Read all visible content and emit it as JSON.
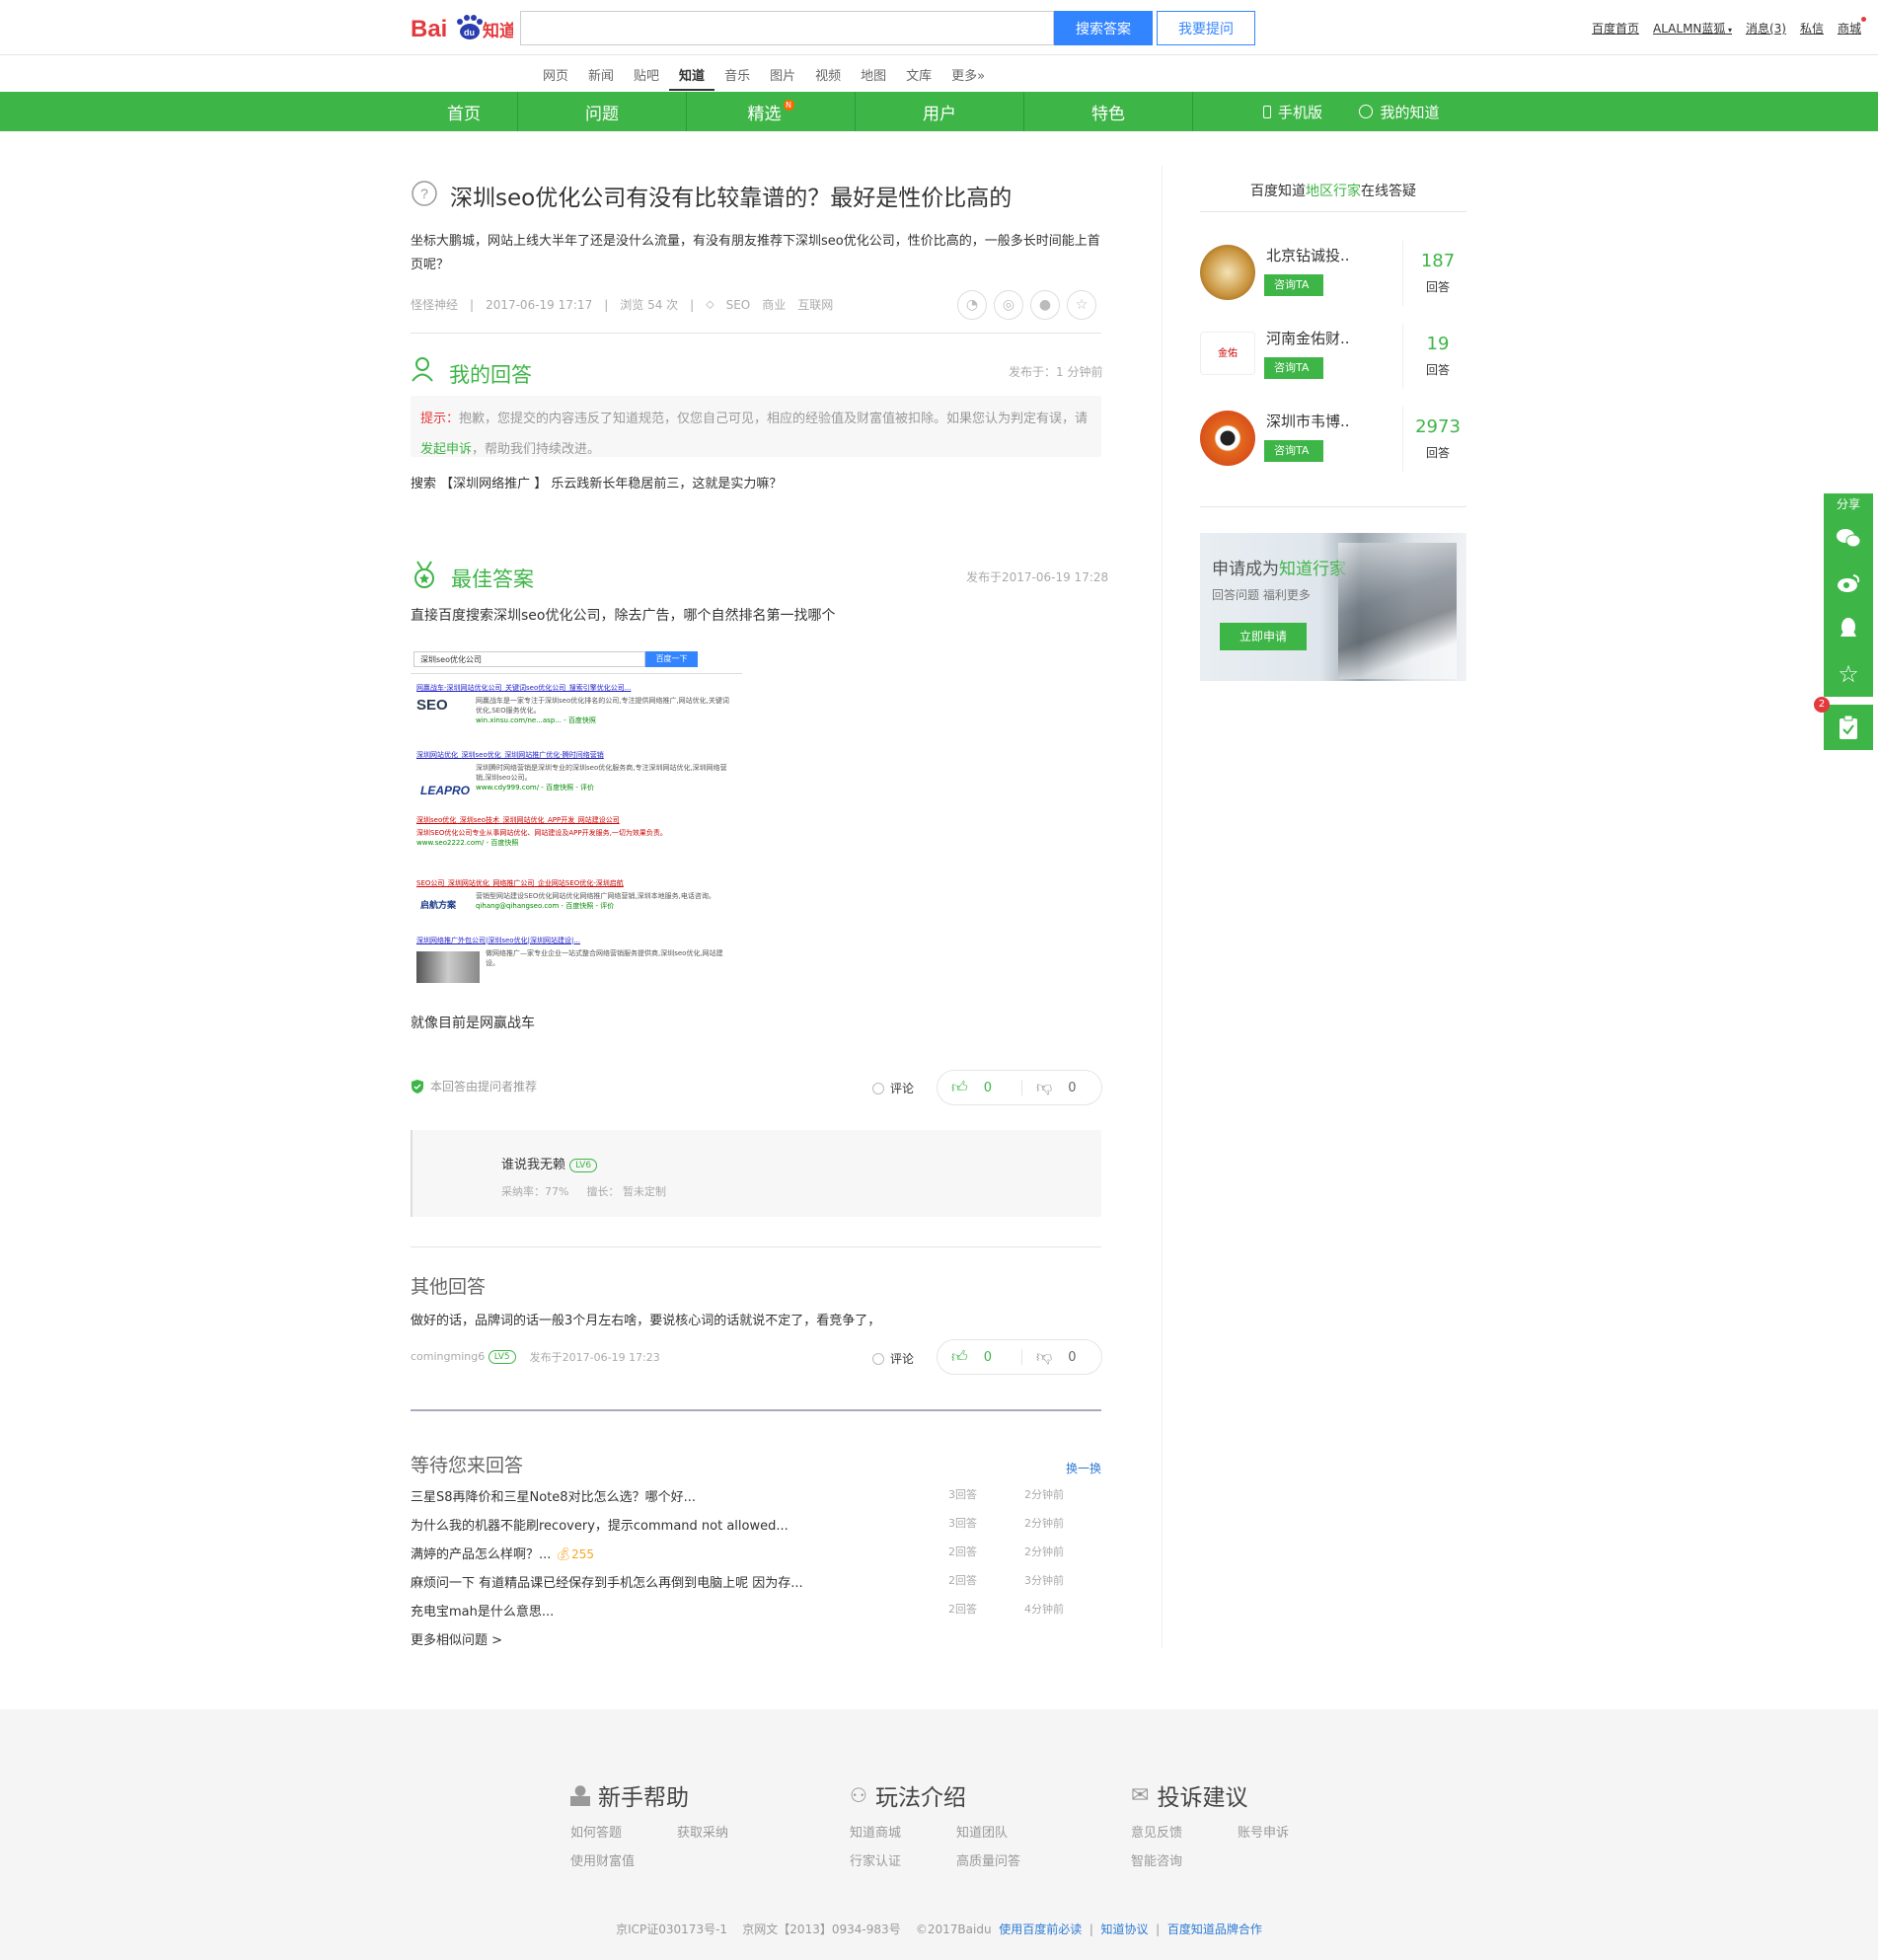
{
  "topbar": {
    "logo_text": "Bai知道",
    "search_value": "",
    "search_button": "搜索答案",
    "ask_button": "我要提问",
    "links": [
      "百度首页",
      "ALALMN蓝狐",
      "消息(3)",
      "私信",
      "商城"
    ]
  },
  "channels": [
    "网页",
    "新闻",
    "贴吧",
    "知道",
    "音乐",
    "图片",
    "视频",
    "地图",
    "文库",
    "更多»"
  ],
  "active_channel": "知道",
  "greennav": {
    "items": [
      "首页",
      "问题",
      "精选",
      "用户",
      "特色"
    ],
    "badge": "N",
    "mobile": "手机版",
    "my": "我的知道"
  },
  "question": {
    "title": "深圳seo优化公司有没有比较靠谱的？最好是性价比高的",
    "body": "坐标大鹏城，网站上线大半年了还是没什么流量，有没有朋友推荐下深圳seo优化公司，性价比高的，一般多长时间能上首页呢？",
    "author": "怪怪神经",
    "date": "2017-06-19 17:17",
    "views": "浏览 54 次",
    "tags": [
      "SEO",
      "商业",
      "互联网"
    ]
  },
  "my_answer": {
    "heading": "我的回答",
    "time": "发布于：1 分钟前",
    "tip_label": "提示：",
    "tip_text": "抱歉，您提交的内容违反了知道规范，仅您自己可见，相应的经验值及财富值被扣除。如果您认为判定有误，请",
    "tip_link": "发起申诉",
    "tip_tail": "，帮助我们持续改进。",
    "content": "搜索 【深圳网络推广 】 乐云践新长年稳居前三，这就是实力嘛？"
  },
  "best_answer": {
    "heading": "最佳答案",
    "time": "发布于2017-06-19 17:28",
    "text": "直接百度搜索深圳seo优化公司，除去广告，哪个自然排名第一找哪个",
    "shot_query": "深圳seo优化公司",
    "shot_button": "百度一下",
    "shot_results": [
      {
        "title": "网赢战车-深圳网站优化公司_关键词seo优化公司_搜索引擎优化公司...",
        "url": "win.xinsu.com/ne...asp... - 百度快照",
        "logo": "SEO"
      },
      {
        "title": "深圳网站优化_深圳seo优化_深圳网站推广优化-腾时间络营销",
        "url": "www.cdy999.com/ - 百度快照 - 评价",
        "logo": "LEAPRO"
      },
      {
        "title": "深圳seo优化_深圳seo技术_深圳网站优化_APP开发_网站建设公司",
        "url": "www.seo2222.com/ - 百度快照",
        "logo": ""
      },
      {
        "title": "SEO公司_深圳网站优化_网络推广公司_企业网站SEO优化-深圳启航",
        "url": "qihang@qihangseo.com - 百度快照 - 评价",
        "logo": "启航方案"
      },
      {
        "title": "深圳网络推广外包公司|深圳seo优化|深圳网站建设|...",
        "url": "",
        "logo": ""
      }
    ],
    "extra": "就像目前是网赢战车",
    "recommend": "本回答由提问者推荐",
    "comment": "评论",
    "up": "0",
    "down": "0",
    "answerer": "谁说我无赖",
    "answerer_level": "LV6",
    "accept_rate": "采纳率：77%",
    "expertise": "擅长：  暂未定制"
  },
  "other_answers": {
    "heading": "其他回答",
    "text": "做好的话，品牌词的话一般3个月左右啥，要说核心词的话就说不定了，看竞争了，",
    "user": "comingming6",
    "level": "LV5",
    "time": "发布于2017-06-19 17:23",
    "comment": "评论",
    "up": "0",
    "down": "0"
  },
  "waiting": {
    "heading": "等待您来回答",
    "refresh": "换一换",
    "items": [
      {
        "q": "三星S8再降价和三星Note8对比怎么选？哪个好...",
        "n": "3回答",
        "t": "2分钟前"
      },
      {
        "q": "为什么我的机器不能刷recovery，提示command not allowed...",
        "n": "3回答",
        "t": "2分钟前"
      },
      {
        "q": "满婷的产品怎么样啊？...",
        "n": "2回答",
        "t": "2分钟前",
        "reward": "255"
      },
      {
        "q": "麻烦问一下 有道精品课已经保存到手机怎么再倒到电脑上呢 因为存...",
        "n": "2回答",
        "t": "3分钟前"
      },
      {
        "q": "充电宝mah是什么意思...",
        "n": "2回答",
        "t": "4分钟前"
      }
    ],
    "more": "更多相似问题 >"
  },
  "sidebar": {
    "title_a": "百度知道",
    "title_b": "地区行家",
    "title_c": "在线答疑",
    "experts": [
      {
        "name": "北京钻诚投..",
        "btn": "咨询TA",
        "count": "187",
        "label": "回答"
      },
      {
        "name": "河南金佑财..",
        "btn": "咨询TA",
        "count": "19",
        "label": "回答"
      },
      {
        "name": "深圳市韦博..",
        "btn": "咨询TA",
        "count": "2973",
        "label": "回答"
      }
    ],
    "banner_a": "申请成为",
    "banner_b": "知道行家",
    "banner_sub": "回答问题  福利更多",
    "banner_btn": "立即申请"
  },
  "share": {
    "label": "分享",
    "badge": "2"
  },
  "footer": {
    "cols": [
      {
        "title": "新手帮助",
        "links": [
          "如何答题",
          "获取采纳",
          "使用财富值"
        ]
      },
      {
        "title": "玩法介绍",
        "links": [
          "知道商城",
          "知道团队",
          "行家认证",
          "高质量问答"
        ]
      },
      {
        "title": "投诉建议",
        "links": [
          "意见反馈",
          "账号申诉",
          "智能咨询"
        ]
      }
    ],
    "copyright": "京ICP证030173号-1    京网文【2013】0934-983号    ©2017Baidu",
    "links": [
      "使用百度前必读",
      "知道协议",
      "百度知道品牌合作"
    ]
  },
  "colors": {
    "green": "#3eb547",
    "blue": "#3385ff",
    "red": "#e4393c"
  }
}
